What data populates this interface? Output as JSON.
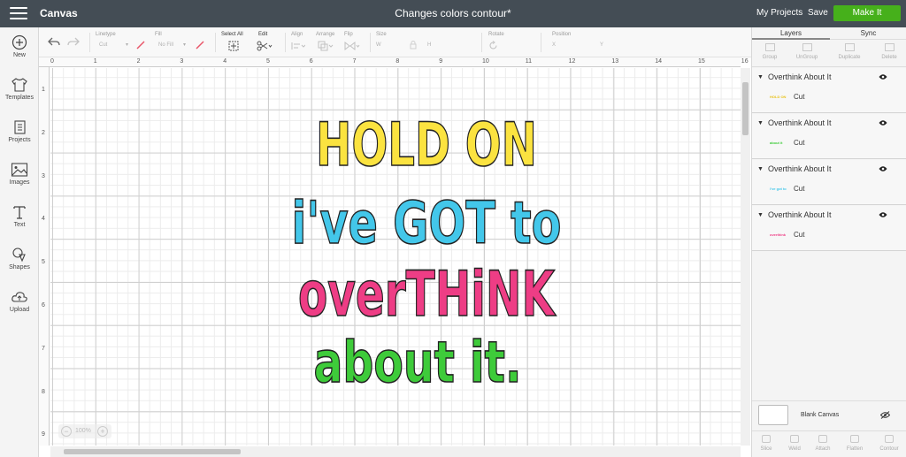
{
  "topbar": {
    "app_title": "Canvas",
    "document_title": "Changes colors contour*",
    "my_projects": "My Projects",
    "save": "Save",
    "make_it": "Make It"
  },
  "sidebar": {
    "items": [
      {
        "label": "New",
        "icon": "plus-circle-icon"
      },
      {
        "label": "Templates",
        "icon": "shirt-icon"
      },
      {
        "label": "Projects",
        "icon": "projects-icon"
      },
      {
        "label": "Images",
        "icon": "image-icon"
      },
      {
        "label": "Text",
        "icon": "text-icon"
      },
      {
        "label": "Shapes",
        "icon": "shapes-icon"
      },
      {
        "label": "Upload",
        "icon": "upload-cloud-icon"
      }
    ]
  },
  "toolbar": {
    "linetype": {
      "label": "Linetype",
      "value": "Cut"
    },
    "fill": {
      "label": "Fill",
      "value": "No Fill"
    },
    "select_all": "Select All",
    "edit": "Edit",
    "align": "Align",
    "arrange": "Arrange",
    "flip": "Flip",
    "size": {
      "label": "Size",
      "w": "W",
      "h": "H"
    },
    "rotate": "Rotate",
    "position": {
      "label": "Position",
      "x": "X",
      "y": "Y"
    }
  },
  "ruler": {
    "top": [
      "0",
      "1",
      "2",
      "3",
      "4",
      "5",
      "6",
      "7",
      "8",
      "9",
      "10",
      "11",
      "12",
      "13",
      "14",
      "15",
      "16"
    ],
    "left": [
      "1",
      "2",
      "3",
      "4",
      "5",
      "6",
      "7",
      "8",
      "9"
    ]
  },
  "artwork": {
    "lines": [
      {
        "text": "HOLD ON",
        "color": "#fbe340"
      },
      {
        "text": "i've GOT to",
        "color": "#43c7ea"
      },
      {
        "text": "overTHiNK",
        "color": "#ee3d85"
      },
      {
        "text": "about it.",
        "color": "#3ecb3a"
      }
    ]
  },
  "zoom": {
    "value": "100%",
    "minus": "−",
    "plus": "+"
  },
  "panel": {
    "tabs": [
      "Layers",
      "Sync"
    ],
    "tools": [
      "Group",
      "UnGroup",
      "Duplicate",
      "Delete"
    ],
    "layers": [
      {
        "name": "Overthink About It",
        "operation": "Cut",
        "thumb_text": "HOLD ON",
        "color": "#e8c21a"
      },
      {
        "name": "Overthink About It",
        "operation": "Cut",
        "thumb_text": "about it",
        "color": "#3ecb3a"
      },
      {
        "name": "Overthink About It",
        "operation": "Cut",
        "thumb_text": "i've got to",
        "color": "#43c7ea"
      },
      {
        "name": "Overthink About It",
        "operation": "Cut",
        "thumb_text": "overthink",
        "color": "#ee3d85"
      }
    ],
    "blank_canvas": "Blank Canvas",
    "bottom_tools": [
      "Slice",
      "Weld",
      "Attach",
      "Flatten",
      "Contour"
    ]
  }
}
